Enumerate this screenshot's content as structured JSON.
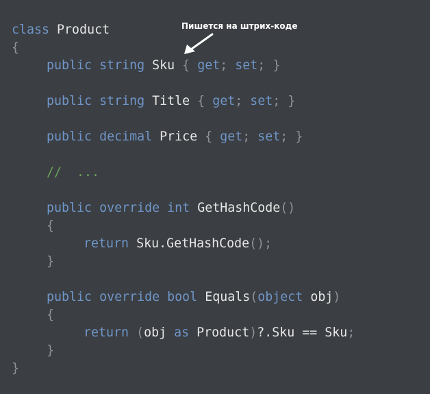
{
  "annotation": {
    "label": "Пишется на штрих-коде"
  },
  "code": {
    "class_kw": "class",
    "class_name": "Product",
    "open_brace": "{",
    "close_brace": "}",
    "kw_public": "public",
    "kw_string": "string",
    "kw_decimal": "decimal",
    "kw_override": "override",
    "kw_int": "int",
    "kw_bool": "bool",
    "kw_return": "return",
    "kw_object": "object",
    "kw_as": "as",
    "kw_get": "get",
    "kw_set": "set",
    "prop_sku": "Sku",
    "prop_title": "Title",
    "prop_price": "Price",
    "comment": "//  ...",
    "method_gethashcode": "GetHashCode",
    "method_equals": "Equals",
    "param_obj": "obj",
    "sku_gethashcode_call": "Sku.GetHashCode",
    "product_type": "Product",
    "null_cond_sku": "?.Sku",
    "eq_op": "==",
    "sku_ref": "Sku",
    "semicolon": ";",
    "open_paren": "(",
    "close_paren": ")",
    "empty_parens": "()"
  },
  "colors": {
    "background": "#3b3e42",
    "keyword": "#6f96c9",
    "identifier": "#e6e6e6",
    "punctuation": "#8e9399",
    "comment": "#6ba45a",
    "annotation": "#ffffff"
  }
}
